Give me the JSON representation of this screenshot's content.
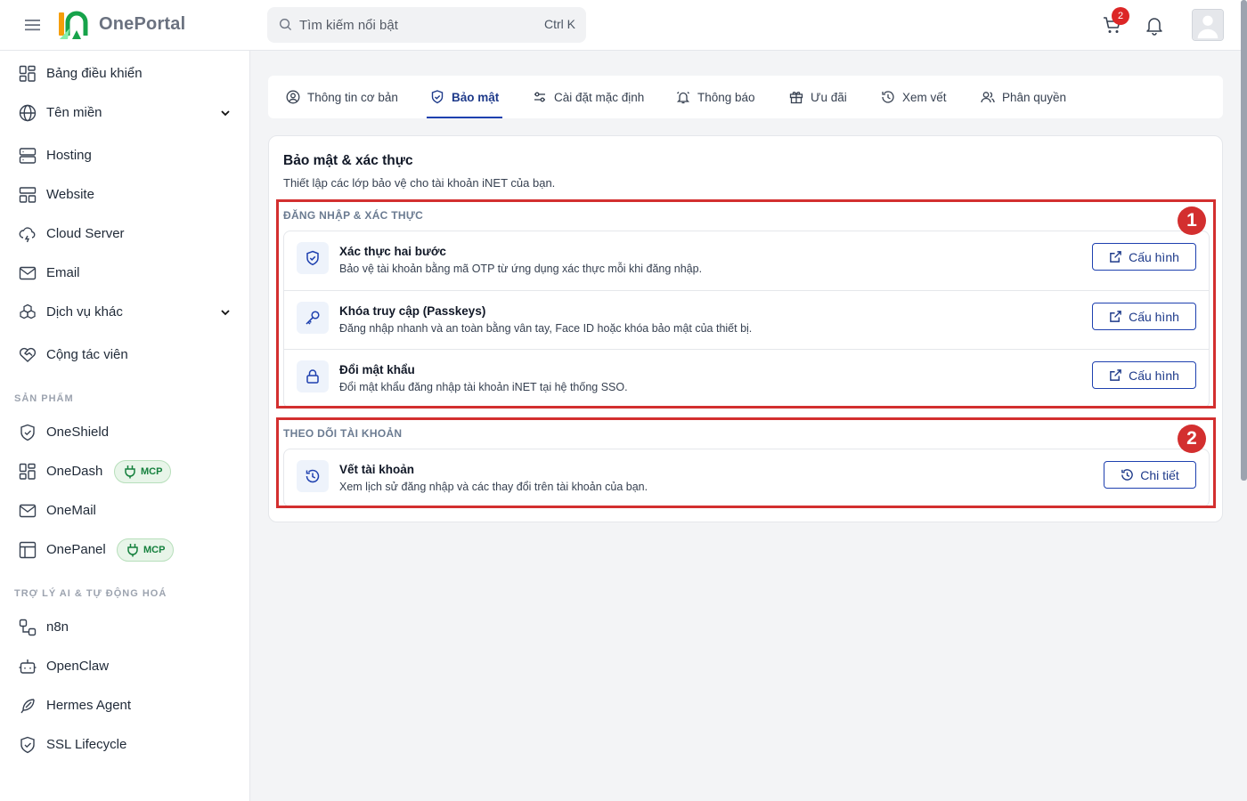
{
  "header": {
    "brand": "OnePortal",
    "search_placeholder": "Tìm kiếm nổi bật",
    "search_shortcut": "Ctrl K",
    "cart_count": "2"
  },
  "sidebar": {
    "items": [
      {
        "label": "Bảng điều khiển",
        "icon": "dashboard-icon"
      },
      {
        "label": "Tên miền",
        "icon": "globe-icon",
        "expandable": true
      },
      {
        "label": "Hosting",
        "icon": "server-icon"
      },
      {
        "label": "Website",
        "icon": "layout-icon"
      },
      {
        "label": "Cloud Server",
        "icon": "cloud-icon"
      },
      {
        "label": "Email",
        "icon": "mail-icon"
      },
      {
        "label": "Dịch vụ khác",
        "icon": "boxes-icon",
        "expandable": true
      },
      {
        "label": "Cộng tác viên",
        "icon": "handshake-icon"
      }
    ],
    "products_label": "SẢN PHẨM",
    "products": [
      {
        "label": "OneShield",
        "icon": "shield-icon"
      },
      {
        "label": "OneDash",
        "icon": "dashboard-icon",
        "badge": "MCP"
      },
      {
        "label": "OneMail",
        "icon": "mail-icon"
      },
      {
        "label": "OnePanel",
        "icon": "panel-icon",
        "badge": "MCP"
      }
    ],
    "ai_label": "TRỢ LÝ AI & TỰ ĐỘNG HOÁ",
    "ai_items": [
      {
        "label": "n8n",
        "icon": "workflow-icon"
      },
      {
        "label": "OpenClaw",
        "icon": "bot-icon"
      },
      {
        "label": "Hermes Agent",
        "icon": "feather-icon"
      },
      {
        "label": "SSL Lifecycle",
        "icon": "shield-check-icon"
      }
    ]
  },
  "tabs": [
    {
      "label": "Thông tin cơ bản",
      "icon": "user-circle-icon"
    },
    {
      "label": "Bảo mật",
      "icon": "shield-icon",
      "active": true
    },
    {
      "label": "Cài đặt mặc định",
      "icon": "sliders-icon"
    },
    {
      "label": "Thông báo",
      "icon": "bell-ring-icon"
    },
    {
      "label": "Ưu đãi",
      "icon": "gift-icon"
    },
    {
      "label": "Xem vết",
      "icon": "history-icon"
    },
    {
      "label": "Phân quyền",
      "icon": "users-icon"
    }
  ],
  "security": {
    "title": "Bảo mật & xác thực",
    "subtitle": "Thiết lập các lớp bảo vệ cho tài khoản iNET của bạn.",
    "login_group": {
      "label": "ĐĂNG NHẬP & XÁC THỰC",
      "rows": [
        {
          "title": "Xác thực hai bước",
          "desc": "Bảo vệ tài khoản bằng mã OTP từ ứng dụng xác thực mỗi khi đăng nhập.",
          "button": "Cấu hình",
          "icon": "shield-check-icon"
        },
        {
          "title": "Khóa truy cập (Passkeys)",
          "desc": "Đăng nhập nhanh và an toàn bằng vân tay, Face ID hoặc khóa bảo mật của thiết bị.",
          "button": "Cấu hình",
          "icon": "key-icon"
        },
        {
          "title": "Đổi mật khẩu",
          "desc": "Đổi mật khẩu đăng nhập tài khoản iNET tại hệ thống SSO.",
          "button": "Cấu hình",
          "icon": "lock-icon"
        }
      ]
    },
    "monitor_group": {
      "label": "THEO DÕI TÀI KHOẢN",
      "rows": [
        {
          "title": "Vết tài khoản",
          "desc": "Xem lịch sử đăng nhập và các thay đổi trên tài khoản của bạn.",
          "button": "Chi tiết",
          "icon": "history-icon"
        }
      ]
    }
  },
  "annotations": [
    "1",
    "2"
  ],
  "colors": {
    "accent": "#1e40af",
    "annotation": "#d32f2f",
    "badge": "#dc2626",
    "logo_green": "#16a34a",
    "logo_orange": "#f59e0b"
  }
}
